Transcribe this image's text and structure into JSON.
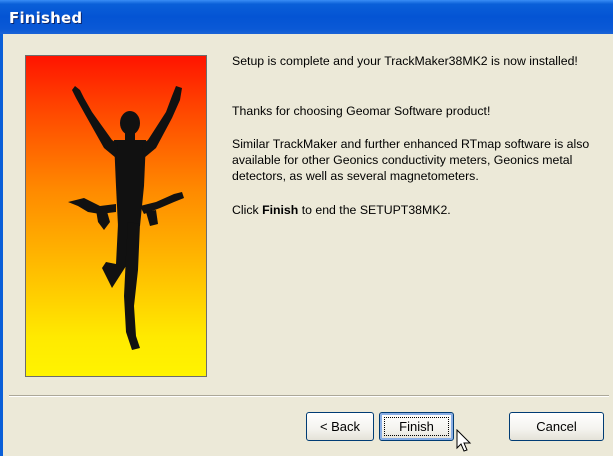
{
  "window": {
    "title": "Finished"
  },
  "banner": {
    "icon": "celebrating-person-silhouette"
  },
  "content": {
    "line1": "Setup is complete and your TrackMaker38MK2 is now installed!",
    "line2": "Thanks for choosing Geomar Software product!",
    "line3": "Similar TrackMaker and further enhanced RTmap software is also available for other Geonics conductivity meters, Geonics metal detectors, as well as several magnetometers.",
    "line4_prefix": "Click ",
    "line4_bold": "Finish",
    "line4_suffix": " to end the SETUPT38MK2."
  },
  "buttons": {
    "back": "< Back",
    "finish": "Finish",
    "cancel": "Cancel"
  },
  "colors": {
    "titlebar": "#0454d4",
    "dialog_bg": "#ece9d8",
    "banner_top": "#ff1400",
    "banner_bottom": "#fff400"
  }
}
